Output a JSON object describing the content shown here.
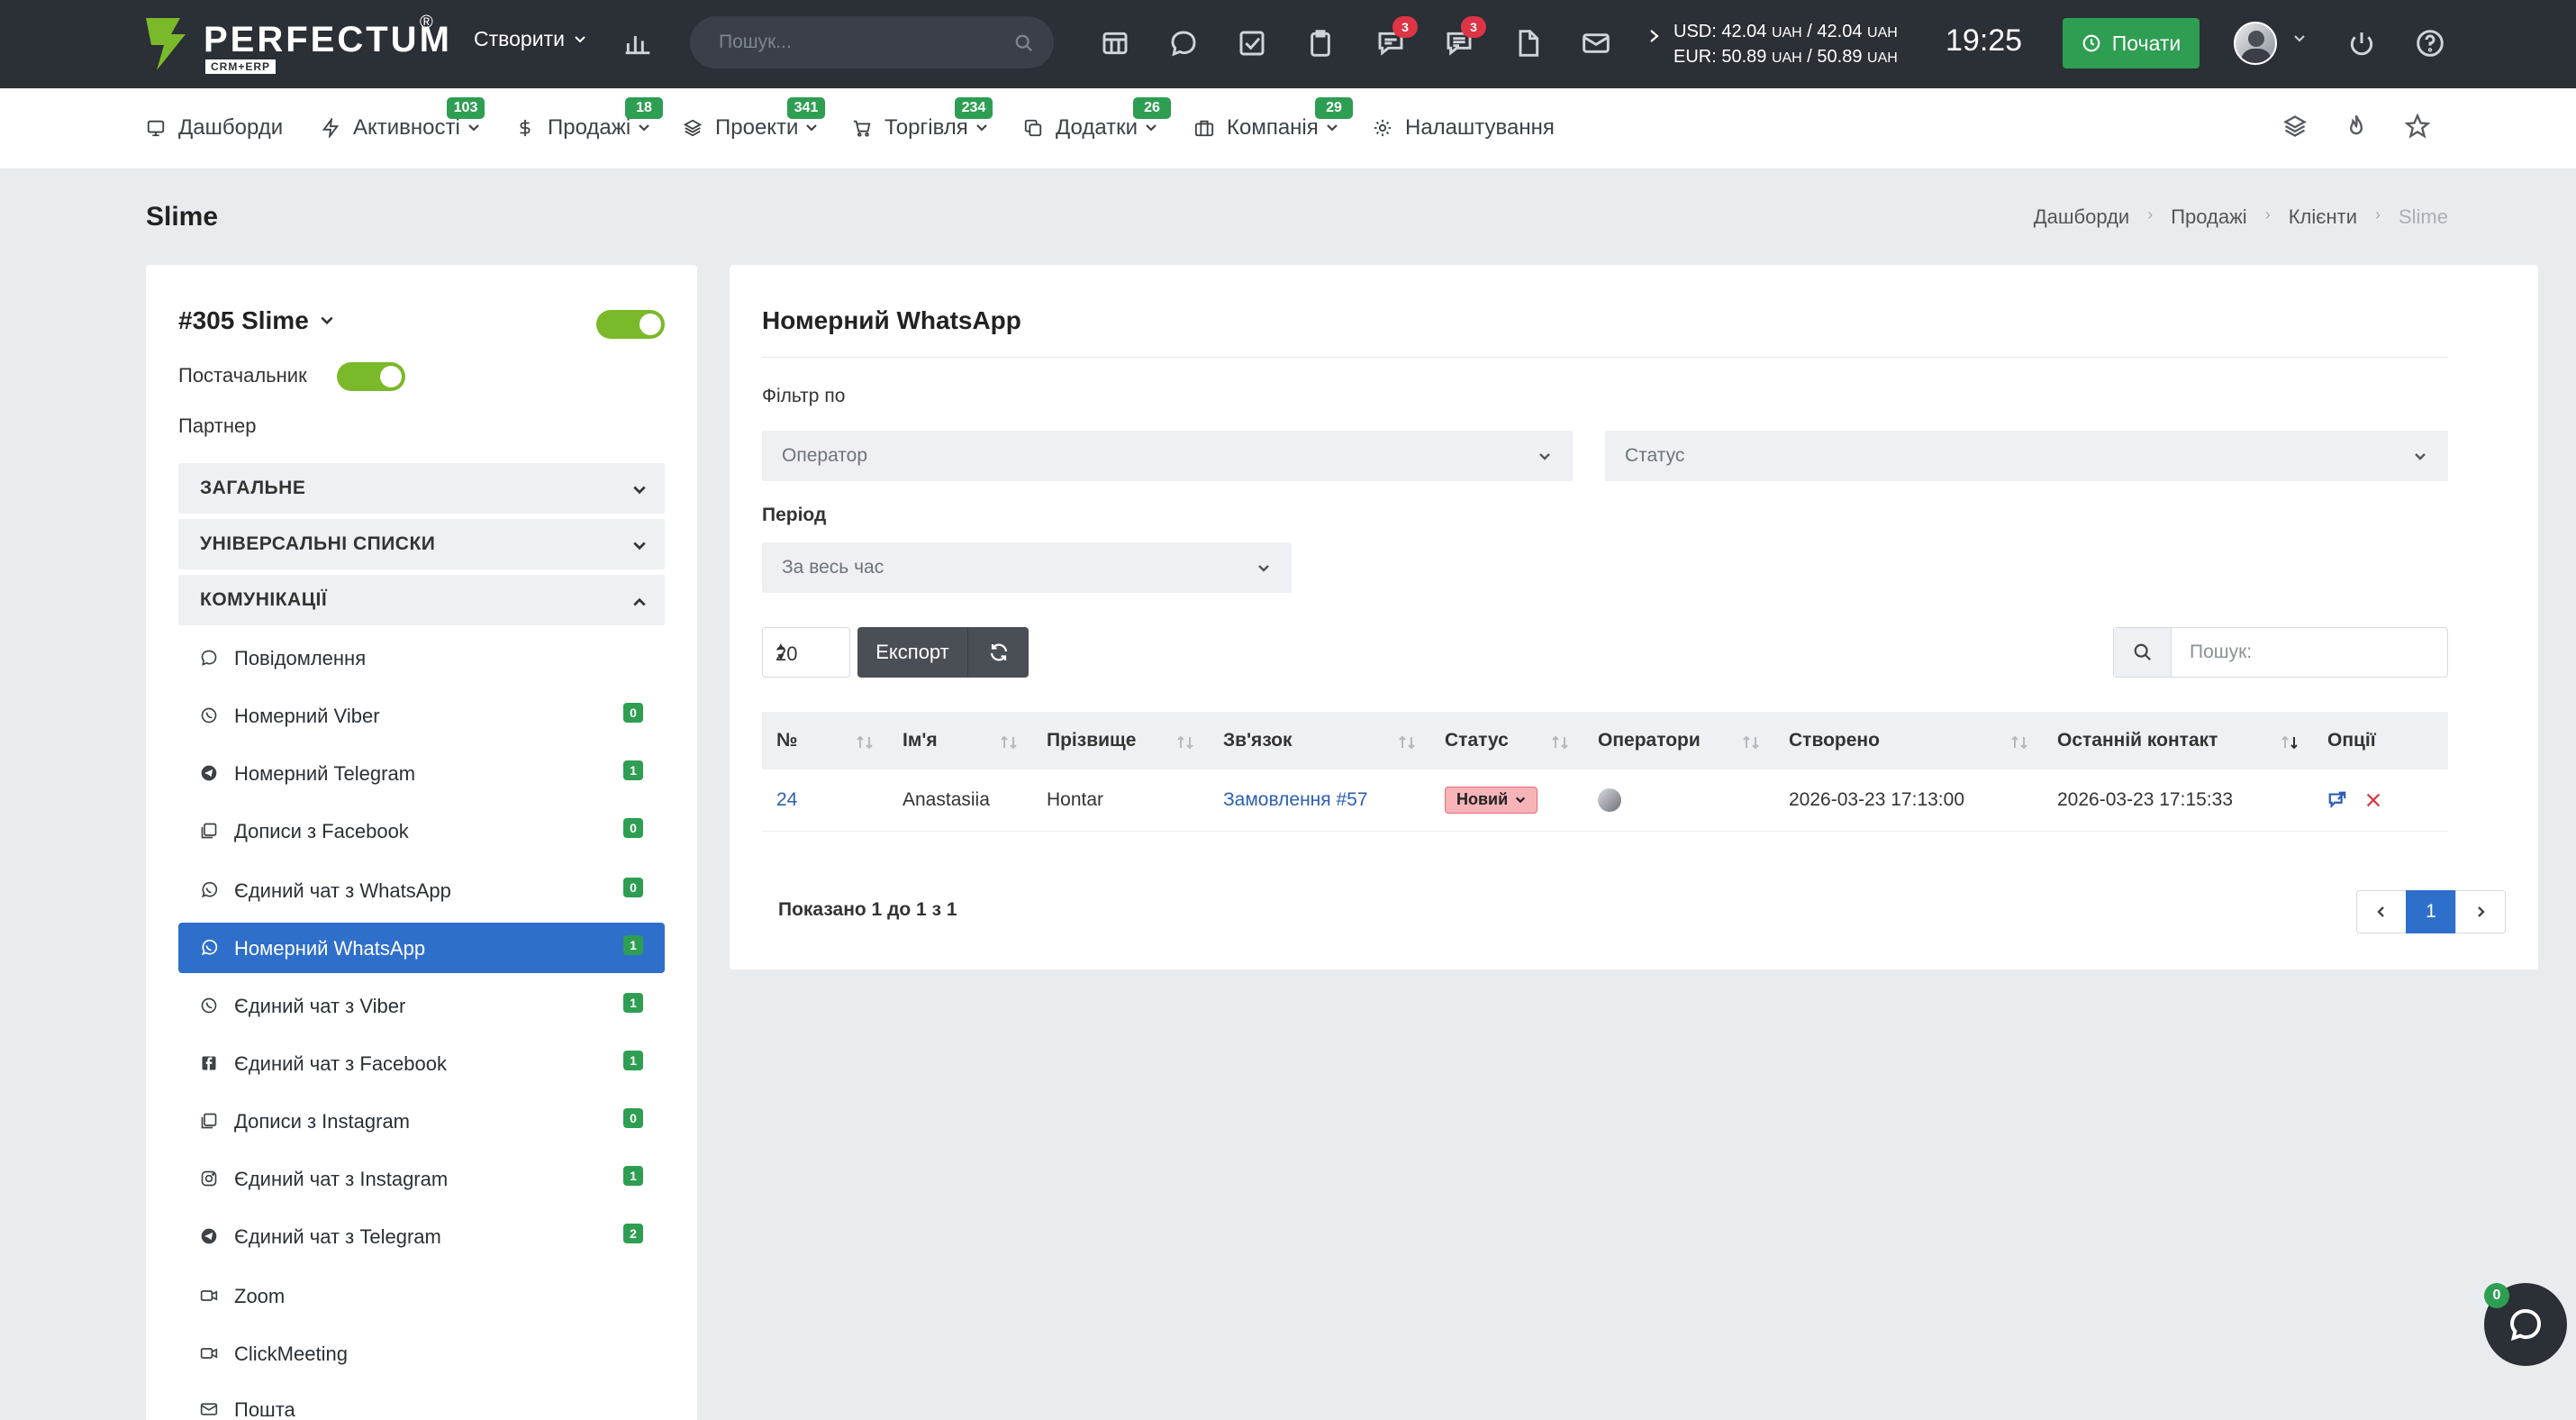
{
  "app": {
    "brand": "PERFECTUM",
    "brand_reg": "®",
    "brand_sub": "CRM+ERP",
    "create_label": "Створити",
    "search_placeholder": "Пошук...",
    "notif_badge_1": "3",
    "notif_badge_2": "3",
    "currency_usd": "USD: 42.04",
    "currency_usd_2": "/ 42.04",
    "currency_eur": "EUR: 50.89",
    "currency_eur_2": "/ 50.89",
    "currency_unit": "UAH",
    "time": "19:25",
    "start_label": "Почати"
  },
  "nav": {
    "items": [
      {
        "label": "Дашборди",
        "badge": ""
      },
      {
        "label": "Активності",
        "badge": "103"
      },
      {
        "label": "Продажі",
        "badge": "18"
      },
      {
        "label": "Проекти",
        "badge": "341"
      },
      {
        "label": "Торгівля",
        "badge": "234"
      },
      {
        "label": "Додатки",
        "badge": "26"
      },
      {
        "label": "Компанія",
        "badge": "29"
      },
      {
        "label": "Налаштування",
        "badge": ""
      }
    ]
  },
  "page": {
    "title": "Slime",
    "breadcrumb": [
      "Дашборди",
      "Продажі",
      "Клієнти",
      "Slime"
    ]
  },
  "client": {
    "title": "#305 Slime",
    "supplier_label": "Постачальник",
    "partner_label": "Партнер",
    "sections": [
      "ЗАГАЛЬНЕ",
      "УНІВЕРСАЛЬНІ СПИСКИ",
      "КОМУНІКАЦІЇ"
    ],
    "comms": [
      {
        "label": "Повідомлення",
        "count": ""
      },
      {
        "label": "Номерний Viber",
        "count": "0"
      },
      {
        "label": "Номерний Telegram",
        "count": "1"
      },
      {
        "label": "Дописи з Facebook",
        "count": "0"
      },
      {
        "label": "Єдиний чат з WhatsApp",
        "count": "0"
      },
      {
        "label": "Номерний WhatsApp",
        "count": "1"
      },
      {
        "label": "Єдиний чат з Viber",
        "count": "1"
      },
      {
        "label": "Єдиний чат з Facebook",
        "count": "1"
      },
      {
        "label": "Дописи з Instagram",
        "count": "0"
      },
      {
        "label": "Єдиний чат з Instagram",
        "count": "1"
      },
      {
        "label": "Єдиний чат з Telegram",
        "count": "2"
      },
      {
        "label": "Zoom",
        "count": ""
      },
      {
        "label": "ClickMeeting",
        "count": ""
      },
      {
        "label": "Пошта",
        "count": ""
      }
    ]
  },
  "main": {
    "title": "Номерний WhatsApp",
    "filter_label": "Фільтр по",
    "operator_placeholder": "Оператор",
    "status_placeholder": "Статус",
    "period_label": "Період",
    "period_value": "За весь час",
    "page_size": "20",
    "export_label": "Експорт",
    "search_placeholder": "Пошук:",
    "columns": [
      "№",
      "Ім'я",
      "Прізвище",
      "Зв'язок",
      "Статус",
      "Оператори",
      "Створено",
      "Останній контакт",
      "Опції"
    ],
    "rows": [
      {
        "num": "24",
        "first_name": "Anastasiia",
        "last_name": "Hontar",
        "relation": "Замовлення #57",
        "status": "Новий",
        "created": "2026-03-23 17:13:00",
        "last_contact": "2026-03-23 17:15:33"
      }
    ],
    "shown_info": "Показано 1 до 1 з 1",
    "current_page": "1"
  },
  "chat": {
    "badge": "0"
  },
  "colors": {
    "topbar": "#2b2f36",
    "accent_green": "#2e9e52",
    "toggle_green": "#7ab929",
    "active_blue": "#2f6fcc",
    "status_new_bg": "#f6b3b8",
    "badge_red": "#dc3545"
  }
}
